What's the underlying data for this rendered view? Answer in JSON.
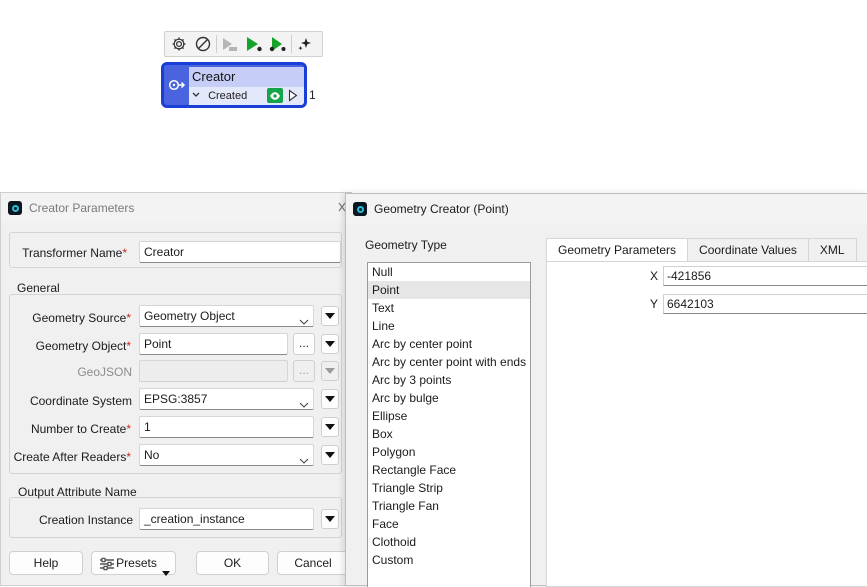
{
  "canvas": {
    "toolbar_icons": [
      "gear-icon",
      "disable-icon",
      "run-to-this-disabled-icon",
      "run-to-this-icon",
      "run-from-this-icon",
      "sparkle-icon"
    ],
    "node": {
      "title": "Creator",
      "port_label": "Created",
      "feature_count": "1",
      "colors": {
        "border": "#1a3fd6",
        "body": "#4a64e0",
        "title_bg": "#c6cdf7",
        "inspect": "#16a34a"
      }
    }
  },
  "creator_dialog": {
    "title": "Creator Parameters",
    "transformer_name_label": "Transformer Name",
    "transformer_name_value": "Creator",
    "general_label": "General",
    "geometry_source_label": "Geometry Source",
    "geometry_source_value": "Geometry Object",
    "geometry_object_label": "Geometry Object",
    "geometry_object_value": "Point",
    "geojson_label": "GeoJSON",
    "coordinate_system_label": "Coordinate System",
    "coordinate_system_value": "EPSG:3857",
    "number_to_create_label": "Number to Create",
    "number_to_create_value": "1",
    "create_after_readers_label": "Create After Readers",
    "create_after_readers_value": "No",
    "output_attr_label": "Output Attribute Name",
    "creation_instance_label": "Creation Instance",
    "creation_instance_value": "_creation_instance",
    "ellipsis": "...",
    "required_mark": "*",
    "buttons": {
      "help": "Help",
      "presets": "Presets",
      "ok": "OK",
      "cancel": "Cancel"
    }
  },
  "geometry_dialog": {
    "title": "Geometry Creator (Point)",
    "geometry_type_label": "Geometry Type",
    "geometry_types": [
      "Null",
      "Point",
      "Text",
      "Line",
      "Arc by center point",
      "Arc by center point with ends",
      "Arc by 3 points",
      "Arc by bulge",
      "Ellipse",
      "Box",
      "Polygon",
      "Rectangle Face",
      "Triangle Strip",
      "Triangle Fan",
      "Face",
      "Clothoid",
      "Custom"
    ],
    "selected_type": "Point",
    "tabs": [
      "Geometry Parameters",
      "Coordinate Values",
      "XML"
    ],
    "active_tab": "Geometry Parameters",
    "x_label": "X",
    "x_value": "-421856",
    "y_label": "Y",
    "y_value": "6642103"
  }
}
